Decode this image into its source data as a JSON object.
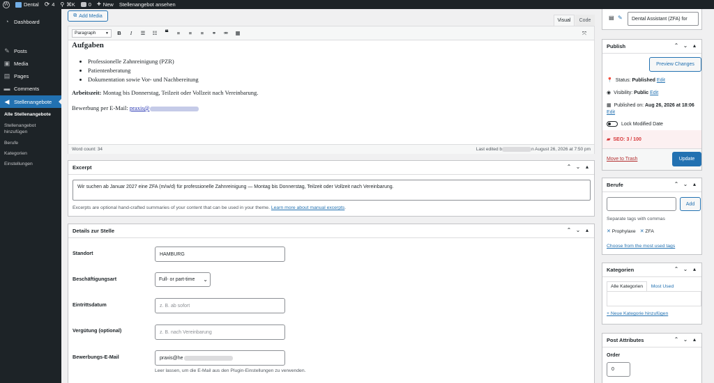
{
  "adminbar": {
    "site": "Dental",
    "updates": "4",
    "shortcut": "⌘K",
    "comments": "0",
    "new": "New",
    "view": "Stellenangebot ansehen"
  },
  "sidebar": {
    "dashboard": "Dashboard",
    "posts": "Posts",
    "media": "Media",
    "pages": "Pages",
    "comments": "Comments",
    "stellen": "Stellenangebote",
    "sub": {
      "all": "Alle Stellenangebote",
      "add_1": "Stellenangebot",
      "add_2": "hinzufügen",
      "berufe": "Berufe",
      "kategorien": "Kategorien",
      "einstellungen": "Einstellungen"
    }
  },
  "editor": {
    "add_media": "Add Media",
    "tab_visual": "Visual",
    "tab_code": "Code",
    "format": "Paragraph",
    "heading": "Aufgaben",
    "bullets": [
      "Professionelle Zahnreinigung (PZR)",
      "Patientenberatung",
      "Dokumentation sowie Vor- und Nachbereitung"
    ],
    "arbeitszeit_label": "Arbeitszeit:",
    "arbeitszeit_text": " Montag bis Donnerstag, Teilzeit oder Vollzeit nach Vereinbarung.",
    "bewerbung_label": "Bewerbung per E-Mail: ",
    "bewerbung_link": "praxis@",
    "word_count": "Word count: 34",
    "last_edited_1": "Last edited b",
    "last_edited_2": "n August 26, 2026 at 7:50 pm"
  },
  "excerpt": {
    "title": "Excerpt",
    "text": "Wir suchen ab Januar 2027 eine ZFA (m/w/d) für professionelle Zahnreinigung — Montag bis Donnerstag, Teilzeit oder Vollzeit nach Vereinbarung.",
    "help": "Excerpts are optional hand-crafted summaries of your content that can be used in your theme. ",
    "help_link": "Learn more about manual excerpts",
    "help_end": "."
  },
  "details": {
    "title": "Details zur Stelle",
    "standort_label": "Standort",
    "standort_value": "HAMBURG",
    "art_label": "Beschäftigungsart",
    "art_value": "Full- or part-time",
    "eintritt_label": "Eintrittsdatum",
    "eintritt_placeholder": "z. B. ab sofort",
    "verguetung_label": "Vergütung (optional)",
    "verguetung_placeholder": "z. B. nach Vereinbarung",
    "email_label": "Bewerbungs-E-Mail",
    "email_value": "praxis@he",
    "email_help": "Leer lassen, um die E-Mail aus den Plugin-Einstellungen zu verwenden."
  },
  "lang": {
    "title_value": "Dental Assistant (ZFA) for"
  },
  "publish": {
    "title": "Publish",
    "preview": "Preview Changes",
    "status_label": "Status: ",
    "status_value": "Published",
    "edit": "Edit",
    "visibility_label": "Visibility: ",
    "visibility_value": "Public",
    "published_label": "Published on: ",
    "published_value": "Aug 26, 2026 at 18:06",
    "lock": "Lock Modified Date",
    "seo": "SEO: 3 / 100",
    "trash": "Move to Trash",
    "update": "Update"
  },
  "berufe": {
    "title": "Berufe",
    "add": "Add",
    "help": "Separate tags with commas",
    "tags": [
      "Prophylaxe",
      "ZFA"
    ],
    "choose": "Choose from the most used tags"
  },
  "kategorien": {
    "title": "Kategorien",
    "tab_all": "Alle Kategorien",
    "tab_used": "Most Used",
    "add_new": "+ Neue Kategorie hinzufügen"
  },
  "attributes": {
    "title": "Post Attributes",
    "order_label": "Order",
    "order_value": "0"
  },
  "colors": {
    "accent": "#2271b1",
    "dark": "#1d2327",
    "seo_bg": "#fcf0f1",
    "seo_text": "#d63638"
  }
}
